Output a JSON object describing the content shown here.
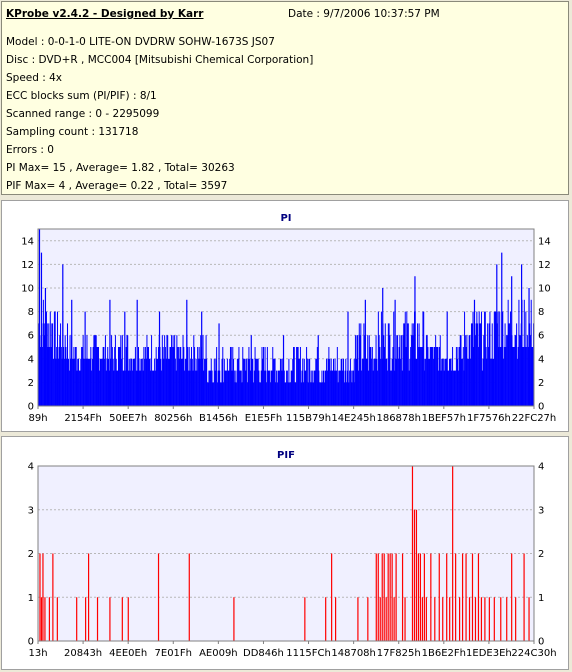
{
  "header": {
    "title": "KProbe v2.4.2 - Designed by Karr",
    "date": "Date : 9/7/2006 10:37:57 PM",
    "lines": [
      "Model : 0-0-1-0 LITE-ON DVDRW SOHW-1673S JS07",
      "Disc : DVD+R , MCC004 [Mitsubishi Chemical Corporation]",
      "Speed : 4x",
      "ECC blocks sum (PI/PIF) : 8/1",
      "Scanned range : 0 - 2295099",
      "Sampling count : 131718",
      "Errors : 0",
      "PI Max= 15 , Average= 1.82 , Total= 30263",
      "PIF Max= 4 , Average= 0.22 , Total= 3597"
    ]
  },
  "chart_data": [
    {
      "type": "bar",
      "title": "PI",
      "ylim": [
        0,
        15
      ],
      "yticks": [
        "0",
        "2",
        "4",
        "6",
        "8",
        "10",
        "12",
        "14"
      ],
      "xticks": [
        "89h",
        "2154Fh",
        "50EE7h",
        "80256h",
        "B1456h",
        "E1E5Fh",
        "115B79h",
        "14E245h",
        "186878h",
        "1BEF57h",
        "1F7576h",
        "22FC27h"
      ],
      "bar_color": "#0000ff",
      "background": "#f0f0ff",
      "grid": true,
      "legend": "none",
      "segments": [
        {
          "from": 0,
          "to": 3,
          "base": 6,
          "spread": 3
        },
        {
          "from": 3,
          "to": 6,
          "base": 5,
          "spread": 3
        },
        {
          "from": 6,
          "to": 28,
          "base": 4,
          "spread": 2
        },
        {
          "from": 28,
          "to": 34,
          "base": 4,
          "spread": 2
        },
        {
          "from": 34,
          "to": 64,
          "base": 3,
          "spread": 2
        },
        {
          "from": 64,
          "to": 68,
          "base": 4,
          "spread": 3
        },
        {
          "from": 68,
          "to": 78,
          "base": 5,
          "spread": 3
        },
        {
          "from": 78,
          "to": 86,
          "base": 4,
          "spread": 2
        },
        {
          "from": 86,
          "to": 92,
          "base": 5,
          "spread": 3
        },
        {
          "from": 92,
          "to": 100,
          "base": 6,
          "spread": 3
        }
      ],
      "peaks": [
        {
          "pos": 0.3,
          "value": 15
        },
        {
          "pos": 0.7,
          "value": 13
        },
        {
          "pos": 1.5,
          "value": 10
        },
        {
          "pos": 5.0,
          "value": 12
        },
        {
          "pos": 6.8,
          "value": 9
        },
        {
          "pos": 9.5,
          "value": 8
        },
        {
          "pos": 14.5,
          "value": 9
        },
        {
          "pos": 17.5,
          "value": 8
        },
        {
          "pos": 20.0,
          "value": 9
        },
        {
          "pos": 24.5,
          "value": 8
        },
        {
          "pos": 30.0,
          "value": 9
        },
        {
          "pos": 33.0,
          "value": 8
        },
        {
          "pos": 36.5,
          "value": 7
        },
        {
          "pos": 43.0,
          "value": 6
        },
        {
          "pos": 49.5,
          "value": 6
        },
        {
          "pos": 56.5,
          "value": 6
        },
        {
          "pos": 62.5,
          "value": 8
        },
        {
          "pos": 66.0,
          "value": 9
        },
        {
          "pos": 69.5,
          "value": 10
        },
        {
          "pos": 72.0,
          "value": 9
        },
        {
          "pos": 76.0,
          "value": 11
        },
        {
          "pos": 82.5,
          "value": 8
        },
        {
          "pos": 88.0,
          "value": 9
        },
        {
          "pos": 92.5,
          "value": 12
        },
        {
          "pos": 93.5,
          "value": 13
        },
        {
          "pos": 95.5,
          "value": 11
        },
        {
          "pos": 97.5,
          "value": 12
        },
        {
          "pos": 99.0,
          "value": 10
        }
      ]
    },
    {
      "type": "bar",
      "title": "PIF",
      "ylim": [
        0,
        4
      ],
      "yticks": [
        "0",
        "1",
        "2",
        "3",
        "4"
      ],
      "xticks": [
        "13h",
        "20843h",
        "4EE0Eh",
        "7E01Fh",
        "AE009h",
        "DD846h",
        "1115FCh",
        "148708h",
        "17F825h",
        "1B6E2Fh",
        "1EDE3Eh",
        "224C30h"
      ],
      "bar_color": "#ff0000",
      "background": "#f0f0ff",
      "grid": true,
      "legend": "none",
      "bars": [
        {
          "pos": 0.4,
          "value": 2
        },
        {
          "pos": 0.7,
          "value": 1
        },
        {
          "pos": 1.0,
          "value": 2
        },
        {
          "pos": 1.4,
          "value": 1
        },
        {
          "pos": 2.3,
          "value": 1
        },
        {
          "pos": 3.0,
          "value": 2
        },
        {
          "pos": 3.9,
          "value": 1
        },
        {
          "pos": 7.8,
          "value": 1
        },
        {
          "pos": 9.6,
          "value": 1
        },
        {
          "pos": 10.2,
          "value": 2
        },
        {
          "pos": 12.0,
          "value": 1
        },
        {
          "pos": 14.5,
          "value": 1
        },
        {
          "pos": 17.0,
          "value": 1
        },
        {
          "pos": 18.2,
          "value": 1
        },
        {
          "pos": 24.3,
          "value": 2
        },
        {
          "pos": 30.5,
          "value": 2
        },
        {
          "pos": 39.5,
          "value": 1
        },
        {
          "pos": 53.8,
          "value": 1
        },
        {
          "pos": 58.0,
          "value": 1
        },
        {
          "pos": 59.2,
          "value": 2
        },
        {
          "pos": 60.0,
          "value": 1
        },
        {
          "pos": 64.5,
          "value": 1
        },
        {
          "pos": 66.5,
          "value": 1
        },
        {
          "pos": 68.2,
          "value": 2
        },
        {
          "pos": 68.6,
          "value": 2
        },
        {
          "pos": 69.0,
          "value": 1
        },
        {
          "pos": 69.4,
          "value": 2
        },
        {
          "pos": 69.8,
          "value": 2
        },
        {
          "pos": 70.2,
          "value": 1
        },
        {
          "pos": 70.6,
          "value": 2
        },
        {
          "pos": 71.0,
          "value": 2
        },
        {
          "pos": 71.4,
          "value": 2
        },
        {
          "pos": 71.8,
          "value": 1
        },
        {
          "pos": 72.2,
          "value": 2
        },
        {
          "pos": 73.5,
          "value": 2
        },
        {
          "pos": 74.0,
          "value": 1
        },
        {
          "pos": 75.5,
          "value": 4
        },
        {
          "pos": 75.9,
          "value": 3
        },
        {
          "pos": 76.3,
          "value": 3
        },
        {
          "pos": 76.7,
          "value": 2
        },
        {
          "pos": 77.1,
          "value": 2
        },
        {
          "pos": 77.5,
          "value": 1
        },
        {
          "pos": 77.9,
          "value": 2
        },
        {
          "pos": 78.3,
          "value": 1
        },
        {
          "pos": 79.2,
          "value": 2
        },
        {
          "pos": 80.0,
          "value": 1
        },
        {
          "pos": 80.9,
          "value": 2
        },
        {
          "pos": 81.6,
          "value": 1
        },
        {
          "pos": 82.4,
          "value": 2
        },
        {
          "pos": 83.0,
          "value": 1
        },
        {
          "pos": 83.6,
          "value": 4
        },
        {
          "pos": 84.2,
          "value": 2
        },
        {
          "pos": 85.0,
          "value": 1
        },
        {
          "pos": 85.6,
          "value": 2
        },
        {
          "pos": 86.3,
          "value": 2
        },
        {
          "pos": 87.0,
          "value": 1
        },
        {
          "pos": 87.6,
          "value": 2
        },
        {
          "pos": 88.2,
          "value": 1
        },
        {
          "pos": 88.8,
          "value": 2
        },
        {
          "pos": 89.4,
          "value": 1
        },
        {
          "pos": 90.1,
          "value": 1
        },
        {
          "pos": 91.0,
          "value": 1
        },
        {
          "pos": 92.0,
          "value": 1
        },
        {
          "pos": 93.3,
          "value": 1
        },
        {
          "pos": 94.5,
          "value": 1
        },
        {
          "pos": 95.5,
          "value": 2
        },
        {
          "pos": 96.3,
          "value": 1
        },
        {
          "pos": 98.0,
          "value": 2
        },
        {
          "pos": 99.0,
          "value": 1
        }
      ]
    }
  ]
}
